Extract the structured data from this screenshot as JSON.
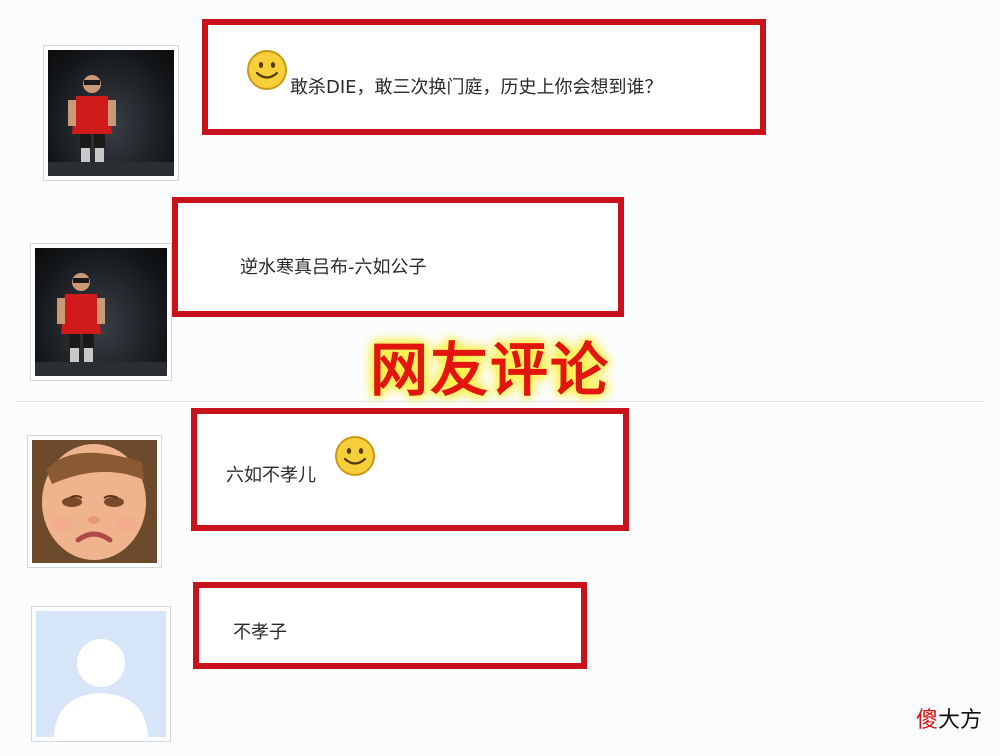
{
  "comments": [
    {
      "avatar": "player-avatar",
      "text": "敢杀DIE，敢三次换门庭，历史上你会想到谁？",
      "emoji": "smiley-emoji"
    },
    {
      "avatar": "player-avatar",
      "text": "逆水寒真吕布-六如公子"
    },
    {
      "avatar": "crying-child-avatar",
      "text": "六如不孝儿",
      "emoji": "smiley-emoji"
    },
    {
      "avatar": "default-user-avatar",
      "text": "不孝子"
    }
  ],
  "overlay_title": "网友评论",
  "watermark": {
    "first": "傻",
    "rest": "大方"
  },
  "colors": {
    "highlight_border": "#c8121c",
    "overlay_text": "#e2160f",
    "overlay_glow": "#fff200"
  }
}
